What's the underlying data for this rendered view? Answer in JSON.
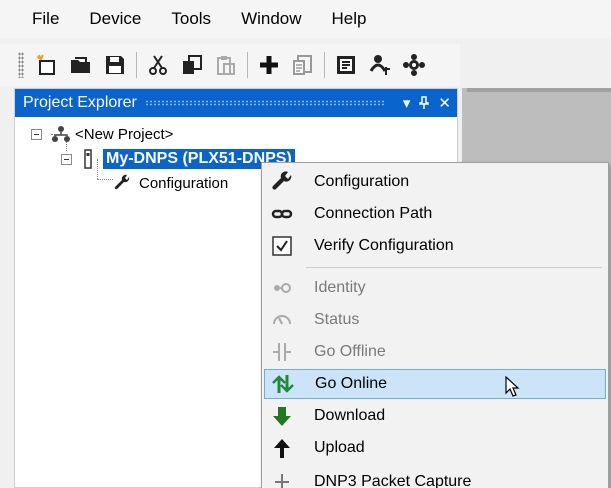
{
  "menubar": {
    "items": [
      "File",
      "Device",
      "Tools",
      "Window",
      "Help"
    ]
  },
  "toolbar": {
    "buttons": [
      "new-project-icon",
      "open-folder-icon",
      "save-icon",
      "cut-icon",
      "copy-icon",
      "paste-icon",
      "add-icon",
      "properties-icon",
      "verify-icon",
      "user-network-icon",
      "settings-gear-icon"
    ]
  },
  "explorer": {
    "title": "Project Explorer",
    "controls": {
      "dropdown": "▾",
      "pin": "▕",
      "close": "✕"
    },
    "tree": {
      "project": "<New Project>",
      "device": "My-DNPS (PLX51-DNPS)",
      "configuration": "Configuration"
    }
  },
  "context_menu": {
    "items": [
      {
        "label": "Configuration",
        "icon": "wrench-icon",
        "enabled": true
      },
      {
        "label": "Connection Path",
        "icon": "link-icon",
        "enabled": true
      },
      {
        "label": "Verify Configuration",
        "icon": "checkbox-icon",
        "enabled": true
      },
      {
        "label": "Identity",
        "icon": "identity-icon",
        "enabled": false
      },
      {
        "label": "Status",
        "icon": "status-icon",
        "enabled": false
      },
      {
        "label": "Go Offline",
        "icon": "go-offline-icon",
        "enabled": false
      },
      {
        "label": "Go Online",
        "icon": "go-online-icon",
        "enabled": true,
        "hovered": true
      },
      {
        "label": "Download",
        "icon": "download-arrow-icon",
        "enabled": true
      },
      {
        "label": "Upload",
        "icon": "upload-arrow-icon",
        "enabled": true
      },
      {
        "label": "DNP3 Packet Capture",
        "icon": "capture-icon",
        "enabled": true
      }
    ]
  },
  "colors": {
    "accent": "#0a64cd",
    "hover": "#cce4f7",
    "download_green": "#1f7a1f",
    "online_green": "#1e8a3a"
  }
}
